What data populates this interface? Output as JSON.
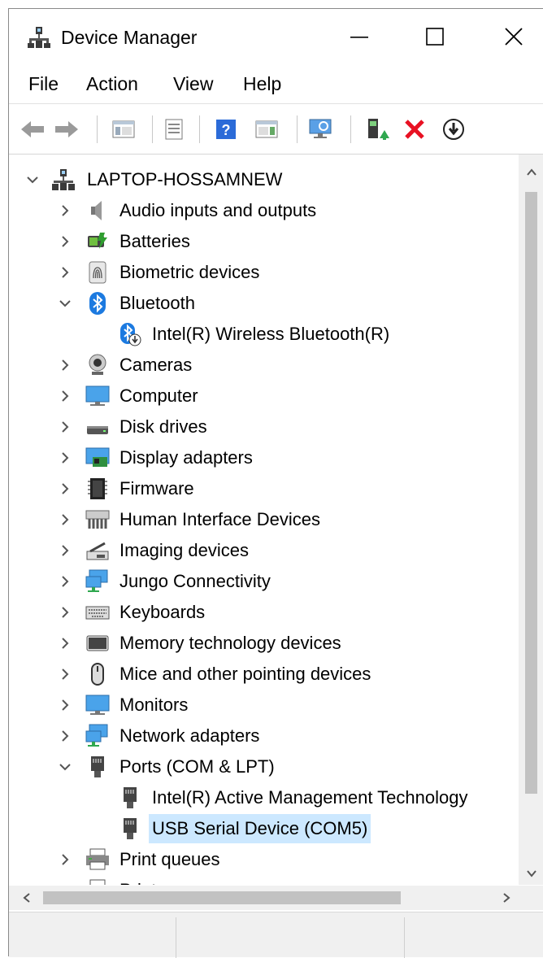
{
  "window": {
    "title": "Device Manager",
    "app_icon": "device-manager-icon"
  },
  "menu": [
    "File",
    "Action",
    "View",
    "Help"
  ],
  "toolbar": {
    "buttons": [
      "back-arrow-icon",
      "forward-arrow-icon",
      "show-hide-console-tree-icon",
      "properties-icon",
      "help-icon",
      "action-pane-icon",
      "scan-hardware-changes-icon",
      "update-driver-icon",
      "uninstall-device-icon",
      "disable-device-icon"
    ],
    "accent_red": "#e81123",
    "help_blue": "#2b6bd8"
  },
  "tree": {
    "root": "LAPTOP-HOSSAMNEW",
    "items": [
      {
        "label": "Audio inputs and outputs",
        "icon": "speaker-icon",
        "state": "collapsed"
      },
      {
        "label": "Batteries",
        "icon": "battery-icon",
        "state": "collapsed"
      },
      {
        "label": "Biometric devices",
        "icon": "fingerprint-icon",
        "state": "collapsed"
      },
      {
        "label": "Bluetooth",
        "icon": "bluetooth-icon",
        "state": "expanded"
      },
      {
        "label": "Intel(R) Wireless Bluetooth(R)",
        "icon": "bluetooth-device-disabled-icon",
        "state": "child"
      },
      {
        "label": "Cameras",
        "icon": "webcam-icon",
        "state": "collapsed"
      },
      {
        "label": "Computer",
        "icon": "computer-monitor-icon",
        "state": "collapsed"
      },
      {
        "label": "Disk drives",
        "icon": "disk-drive-icon",
        "state": "collapsed"
      },
      {
        "label": "Display adapters",
        "icon": "display-adapter-icon",
        "state": "collapsed"
      },
      {
        "label": "Firmware",
        "icon": "firmware-chip-icon",
        "state": "collapsed"
      },
      {
        "label": "Human Interface Devices",
        "icon": "hid-icon",
        "state": "collapsed"
      },
      {
        "label": "Imaging devices",
        "icon": "scanner-icon",
        "state": "collapsed"
      },
      {
        "label": "Jungo Connectivity",
        "icon": "network-monitor-icon",
        "state": "collapsed"
      },
      {
        "label": "Keyboards",
        "icon": "keyboard-icon",
        "state": "collapsed"
      },
      {
        "label": "Memory technology devices",
        "icon": "memory-card-icon",
        "state": "collapsed"
      },
      {
        "label": "Mice and other pointing devices",
        "icon": "mouse-icon",
        "state": "collapsed"
      },
      {
        "label": "Monitors",
        "icon": "monitor-icon",
        "state": "collapsed"
      },
      {
        "label": "Network adapters",
        "icon": "network-adapter-icon",
        "state": "collapsed"
      },
      {
        "label": "Ports (COM & LPT)",
        "icon": "port-connector-icon",
        "state": "expanded"
      },
      {
        "label": "Intel(R) Active Management Technology",
        "icon": "port-connector-icon",
        "state": "child"
      },
      {
        "label": "USB Serial Device (COM5)",
        "icon": "port-connector-icon",
        "state": "child",
        "selected": true
      },
      {
        "label": "Print queues",
        "icon": "printer-icon",
        "state": "collapsed"
      },
      {
        "label": "Printers",
        "icon": "printer-icon",
        "state": "collapsed"
      }
    ],
    "selection_color": "#cce8ff"
  }
}
